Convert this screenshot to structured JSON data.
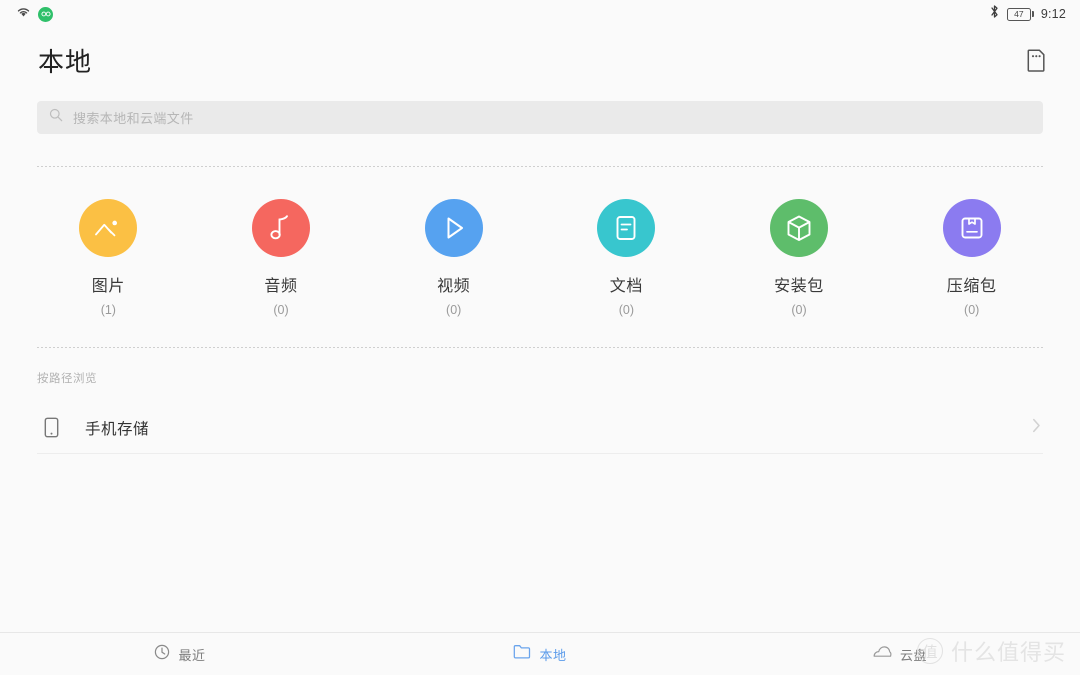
{
  "statusbar": {
    "wifi_icon": "wifi-icon",
    "data_badge_icon": "green-data-badge-icon",
    "bluetooth_icon": "bluetooth-icon",
    "battery_level": "47",
    "time": "9:12"
  },
  "header": {
    "title": "本地",
    "action_icon": "sd-card-storage-icon"
  },
  "search": {
    "icon": "search-icon",
    "placeholder": "搜索本地和云端文件"
  },
  "categories": [
    {
      "label": "图片",
      "count": "(1)",
      "color": "#FBC044",
      "icon": "image-icon"
    },
    {
      "label": "音频",
      "count": "(0)",
      "color": "#F5675F",
      "icon": "music-note-icon"
    },
    {
      "label": "视频",
      "count": "(0)",
      "color": "#56A2F0",
      "icon": "play-triangle-icon"
    },
    {
      "label": "文档",
      "count": "(0)",
      "color": "#38C6CE",
      "icon": "document-icon"
    },
    {
      "label": "安装包",
      "count": "(0)",
      "color": "#5EBD6B",
      "icon": "package-cube-icon"
    },
    {
      "label": "压缩包",
      "count": "(0)",
      "color": "#8B7BF0",
      "icon": "archive-box-icon"
    }
  ],
  "path_section": {
    "label": "按路径浏览",
    "items": [
      {
        "label": "手机存储",
        "icon": "phone-icon",
        "chevron": "chevron-right-icon"
      }
    ]
  },
  "bottom_nav": [
    {
      "label": "最近",
      "icon": "clock-icon",
      "active": false
    },
    {
      "label": "本地",
      "icon": "folder-icon",
      "active": true
    },
    {
      "label": "云盘",
      "icon": "cloud-icon",
      "active": false
    }
  ],
  "watermark": {
    "mark": "值",
    "text": "什么值得买"
  },
  "colors": {
    "accent": "#5b9bea",
    "background": "#fafafa",
    "search_bg": "#eaeaea"
  }
}
